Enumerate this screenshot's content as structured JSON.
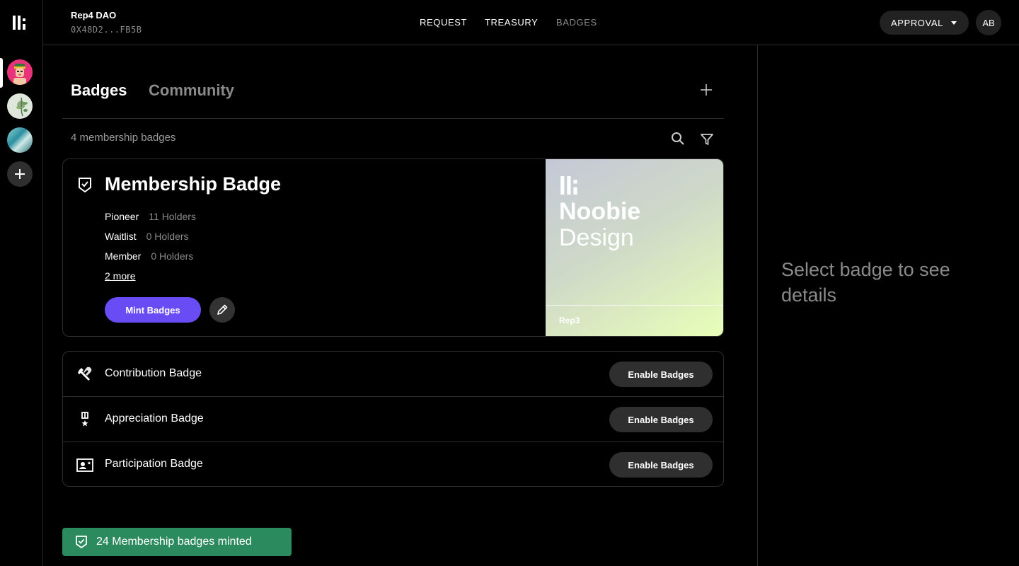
{
  "header": {
    "dao_name": "Rep4 DAO",
    "dao_address": "0X48D2...FB5B",
    "nav": [
      "REQUEST",
      "TREASURY",
      "BADGES"
    ],
    "approval_label": "APPROVAL",
    "user_initials": "AB"
  },
  "tabs": {
    "badges": "Badges",
    "community": "Community"
  },
  "badges_count_text": "4 membership badges",
  "membership_card": {
    "title": "Membership Badge",
    "tiers": [
      {
        "name": "Pioneer",
        "holders": "11 Holders"
      },
      {
        "name": "Waitlist",
        "holders": "0 Holders"
      },
      {
        "name": "Member",
        "holders": "0 Holders"
      }
    ],
    "more_link": "2 more",
    "mint_label": "Mint Badges",
    "art": {
      "title": "Noobie",
      "subtitle": "Design",
      "footer": "Rep3"
    }
  },
  "badge_list": [
    {
      "label": "Contribution Badge",
      "icon": "tools-icon",
      "action": "Enable Badges"
    },
    {
      "label": "Appreciation Badge",
      "icon": "medal-icon",
      "action": "Enable Badges"
    },
    {
      "label": "Participation Badge",
      "icon": "id-card-icon",
      "action": "Enable Badges"
    }
  ],
  "toast_text": "24 Membership badges minted",
  "detail_placeholder": "Select badge to see details",
  "colors": {
    "accent": "#6a4cf5",
    "toast": "#2c8a5f",
    "muted": "#8a8a8a"
  }
}
